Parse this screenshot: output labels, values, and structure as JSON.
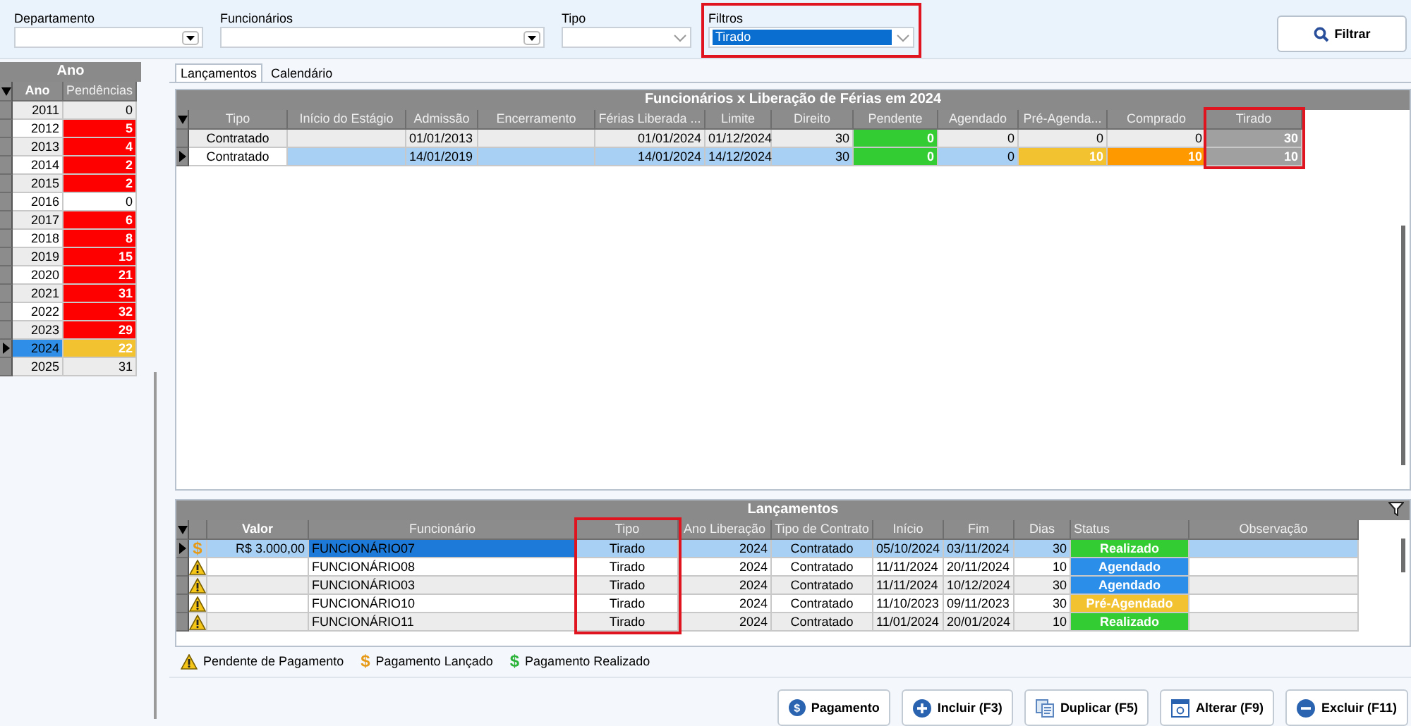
{
  "filters": [
    {
      "label": "Departamento",
      "kind": "combo"
    },
    {
      "label": "Funcionários",
      "kind": "combo"
    },
    {
      "label": "Tipo",
      "kind": "dropdown"
    },
    {
      "label": "Filtros",
      "kind": "dropdown",
      "value": "Tirado",
      "highlighted": true
    }
  ],
  "filter_button": {
    "label": "Filtrar"
  },
  "years": {
    "title": "Ano",
    "columns": [
      "Ano",
      "Pendências"
    ],
    "rows": [
      {
        "year": "2011",
        "pending": "0",
        "selected": false
      },
      {
        "year": "2012",
        "pending": "5",
        "color": "#ff0000",
        "selected": false
      },
      {
        "year": "2013",
        "pending": "4",
        "color": "#ff0000",
        "selected": false
      },
      {
        "year": "2014",
        "pending": "2",
        "color": "#ff0000",
        "selected": false
      },
      {
        "year": "2015",
        "pending": "2",
        "color": "#ff0000",
        "selected": false
      },
      {
        "year": "2016",
        "pending": "0",
        "selected": false
      },
      {
        "year": "2017",
        "pending": "6",
        "color": "#ff0000",
        "selected": false
      },
      {
        "year": "2018",
        "pending": "8",
        "color": "#ff0000",
        "selected": false
      },
      {
        "year": "2019",
        "pending": "15",
        "color": "#ff0000",
        "selected": false
      },
      {
        "year": "2020",
        "pending": "21",
        "color": "#ff0000",
        "selected": false
      },
      {
        "year": "2021",
        "pending": "31",
        "color": "#ff0000",
        "selected": false
      },
      {
        "year": "2022",
        "pending": "32",
        "color": "#ff0000",
        "selected": false
      },
      {
        "year": "2023",
        "pending": "29",
        "color": "#ff0000",
        "selected": false
      },
      {
        "year": "2024",
        "pending": "22",
        "color": "#f2c230",
        "selected": true
      },
      {
        "year": "2025",
        "pending": "31",
        "selected": false
      }
    ]
  },
  "tabs": [
    {
      "label": "Lançamentos",
      "selected": true
    },
    {
      "label": "Calendário",
      "selected": false
    }
  ],
  "summary": {
    "title": "Funcionários x Liberação de Férias em 2024",
    "columns": [
      {
        "label": "Tipo"
      },
      {
        "label": "Início do Estágio"
      },
      {
        "label": "Admissão"
      },
      {
        "label": "Encerramento"
      },
      {
        "label": "Férias Liberada ..."
      },
      {
        "label": "Limite"
      },
      {
        "label": "Direito"
      },
      {
        "label": "Pendente"
      },
      {
        "label": "Agendado"
      },
      {
        "label": "Pré-Agenda..."
      },
      {
        "label": "Comprado"
      },
      {
        "label": "Tirado",
        "highlighted": true
      }
    ],
    "rows": [
      {
        "selected": false,
        "cells": [
          {
            "text": "Contratado"
          },
          {},
          {
            "text": "01/01/2013"
          },
          {},
          {
            "text": "01/01/2024"
          },
          {
            "text": "01/12/2024"
          },
          {
            "text": "30"
          },
          {
            "text": "0",
            "color": "#33cc33"
          },
          {
            "text": "0"
          },
          {
            "text": "0"
          },
          {
            "text": "0"
          },
          {
            "text": "30",
            "color": "#a0a0a0"
          }
        ]
      },
      {
        "selected": true,
        "cells": [
          {
            "text": "Contratado"
          },
          {},
          {
            "text": "14/01/2019"
          },
          {},
          {
            "text": "14/01/2024"
          },
          {
            "text": "14/12/2024"
          },
          {
            "text": "30"
          },
          {
            "text": "0",
            "color": "#33cc33"
          },
          {
            "text": "0"
          },
          {
            "text": "10",
            "color": "#f2c230"
          },
          {
            "text": "10",
            "color": "#ff9900"
          },
          {
            "text": "10",
            "color": "#a0a0a0"
          }
        ]
      }
    ]
  },
  "entries": {
    "title": "Lançamentos",
    "columns": [
      {
        "label": "Valor"
      },
      {
        "label": "Funcionário"
      },
      {
        "label": "Tipo",
        "highlighted": true
      },
      {
        "label": "Ano Liberação"
      },
      {
        "label": "Tipo de Contrato"
      },
      {
        "label": "Início"
      },
      {
        "label": "Fim"
      },
      {
        "label": "Dias"
      },
      {
        "label": "Status"
      },
      {
        "label": "Observação"
      }
    ],
    "rows": [
      {
        "selected": true,
        "icon": {
          "kind": "launched",
          "symbol": "$"
        },
        "valor": "R$ 3.000,00",
        "funcionario": "FUNCIONÁRIO07",
        "tipo": "Tirado",
        "ano": "2024",
        "contrato": "Contratado",
        "inicio": "05/10/2024",
        "fim": "03/11/2024",
        "dias": "30",
        "status": {
          "text": "Realizado",
          "color": "#33cc33"
        }
      },
      {
        "selected": false,
        "icon": {
          "kind": "pending"
        },
        "funcionario": "FUNCIONÁRIO08",
        "tipo": "Tirado",
        "ano": "2024",
        "contrato": "Contratado",
        "inicio": "11/11/2024",
        "fim": "20/11/2024",
        "dias": "10",
        "status": {
          "text": "Agendado",
          "color": "#2b8ee8"
        }
      },
      {
        "selected": false,
        "icon": {
          "kind": "pending"
        },
        "funcionario": "FUNCIONÁRIO03",
        "tipo": "Tirado",
        "ano": "2024",
        "contrato": "Contratado",
        "inicio": "11/11/2024",
        "fim": "10/12/2024",
        "dias": "30",
        "status": {
          "text": "Agendado",
          "color": "#2b8ee8"
        }
      },
      {
        "selected": false,
        "icon": {
          "kind": "pending"
        },
        "funcionario": "FUNCIONÁRIO10",
        "tipo": "Tirado",
        "ano": "2024",
        "contrato": "Contratado",
        "inicio": "11/10/2023",
        "fim": "09/11/2023",
        "dias": "30",
        "status": {
          "text": "Pré-Agendado",
          "color": "#f2c230"
        }
      },
      {
        "selected": false,
        "icon": {
          "kind": "pending"
        },
        "funcionario": "FUNCIONÁRIO11",
        "tipo": "Tirado",
        "ano": "2024",
        "contrato": "Contratado",
        "inicio": "11/01/2024",
        "fim": "20/01/2024",
        "dias": "10",
        "status": {
          "text": "Realizado",
          "color": "#33cc33"
        }
      }
    ]
  },
  "legend": [
    {
      "kind": "pending",
      "label": "Pendente de Pagamento"
    },
    {
      "kind": "launched",
      "symbol": "$",
      "label": "Pagamento Lançado"
    },
    {
      "kind": "paid",
      "symbol": "$",
      "label": "Pagamento Realizado"
    }
  ],
  "buttons": [
    {
      "kind": "payment",
      "symbol": "$",
      "label": "Pagamento"
    },
    {
      "kind": "add",
      "label": "Incluir (F3)"
    },
    {
      "kind": "duplicate",
      "label": "Duplicar (F5)"
    },
    {
      "kind": "edit",
      "label": "Alterar (F9)"
    },
    {
      "kind": "delete",
      "label": "Excluir (F11)"
    }
  ]
}
